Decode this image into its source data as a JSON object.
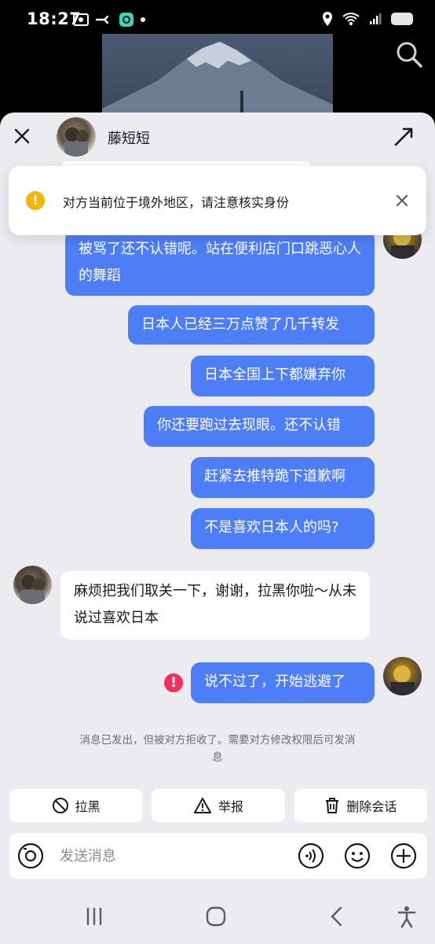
{
  "status_bar": {
    "time": "18:27"
  },
  "chat": {
    "contact_name": "藤短短",
    "warning_text": "对方当前位于境外地区，请注意核实身份",
    "messages": [
      {
        "from": "me",
        "text": "被骂了还不认错呢。站在便利店门口跳恶心人的舞蹈"
      },
      {
        "from": "me",
        "text": "日本人已经三万点赞了几千转发"
      },
      {
        "from": "me",
        "text": "日本全国上下都嫌弃你"
      },
      {
        "from": "me",
        "text": "你还要跑过去现眼。还不认错"
      },
      {
        "from": "me",
        "text": "赶紧去推特跪下道歉啊"
      },
      {
        "from": "me",
        "text": "不是喜欢日本人的吗?"
      },
      {
        "from": "other",
        "text": "麻烦把我们取关一下，谢谢，拉黑你啦～从未说过喜欢日本"
      },
      {
        "from": "me",
        "text": "说不过了，开始逃避了",
        "failed": true
      }
    ],
    "system_note": "消息已发出，但被对方拒收了。需要对方修改权限后可发消息"
  },
  "actions": {
    "block": "拉黑",
    "report": "举报",
    "delete": "删除会话"
  },
  "composer": {
    "placeholder": "发送消息"
  },
  "colors": {
    "bubble_me": "#4e7ef7",
    "warning": "#f5b400",
    "error": "#f2305a",
    "sheet_bg": "#ececf0"
  },
  "icons": [
    "search-icon",
    "close-icon",
    "expand-icon",
    "warning-icon",
    "error-icon",
    "block-icon",
    "report-icon",
    "trash-icon",
    "camera-icon",
    "voice-icon",
    "emoji-icon",
    "plus-icon"
  ]
}
